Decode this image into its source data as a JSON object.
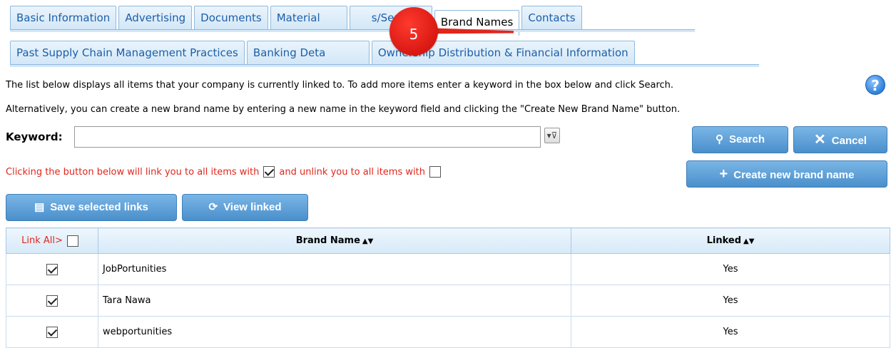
{
  "tabs_row1": [
    {
      "label": "Basic Information",
      "active": false
    },
    {
      "label": "Advertising",
      "active": false
    },
    {
      "label": "Documents",
      "active": false
    },
    {
      "label": "Material",
      "active": false
    },
    {
      "label": "s/Services",
      "active": false
    },
    {
      "label": "Brand Names",
      "active": true
    },
    {
      "label": "Contacts",
      "active": false
    }
  ],
  "tabs_row2": [
    {
      "label": "Past Supply Chain Management Practices"
    },
    {
      "label": "Banking Deta"
    },
    {
      "label": "Ownership Distribution & Financial Information"
    }
  ],
  "annotation": {
    "number": "5",
    "color": "#e0261c"
  },
  "info": {
    "line1": "The list below displays all items that your company is currently linked to. To add more items enter a keyword in the box below and click Search.",
    "line2": "Alternatively, you can create a new brand name by entering a new name in the keyword field and clicking the \"Create New Brand Name\" button.",
    "help": "?"
  },
  "keyword": {
    "label": "Keyword:",
    "value": "",
    "placeholder": ""
  },
  "buttons": {
    "search": "Search",
    "cancel": "Cancel",
    "create": "Create new brand name",
    "save": "Save selected links",
    "view": "View linked"
  },
  "notice": {
    "part1": "Clicking the button below will link you to all items with",
    "part2": "and unlink you to all items with"
  },
  "table": {
    "link_all": "Link All>",
    "col_brand": "Brand Name",
    "col_linked": "Linked",
    "rows": [
      {
        "checked": true,
        "brand": "JobPortunities",
        "linked": "Yes"
      },
      {
        "checked": true,
        "brand": "Tara Nawa",
        "linked": "Yes"
      },
      {
        "checked": true,
        "brand": "webportunities",
        "linked": "Yes"
      }
    ]
  },
  "colors": {
    "tab_text": "#1d5fa8",
    "button": "#4a8fcb",
    "notice": "#e0261c"
  }
}
